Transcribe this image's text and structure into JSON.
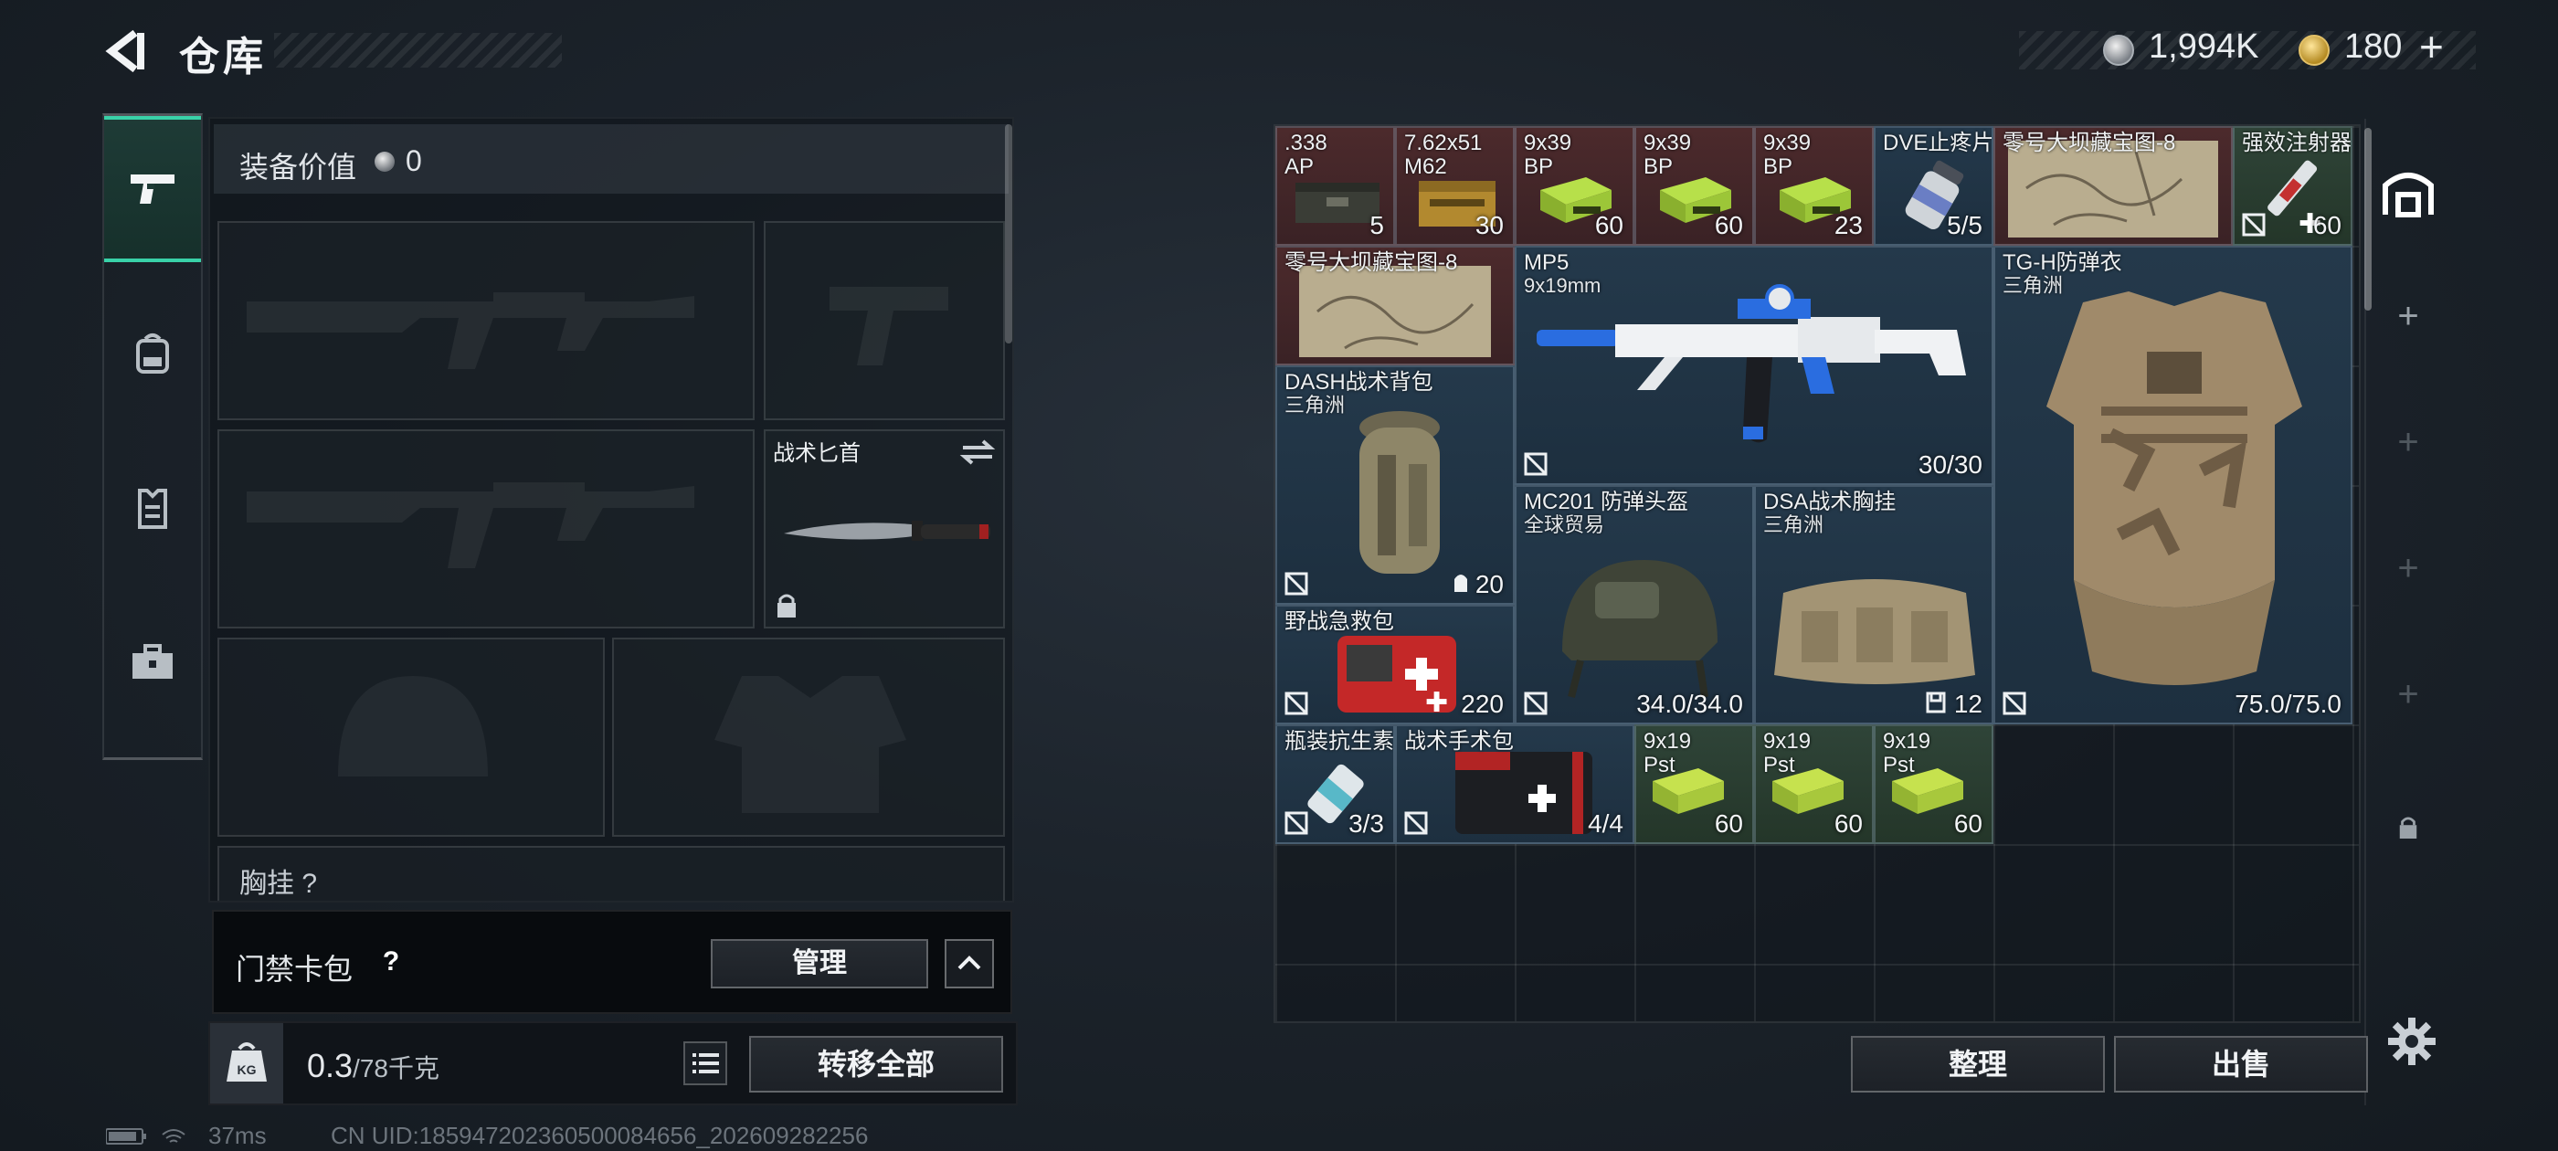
{
  "header": {
    "title": "仓库",
    "coins": "1,994K",
    "tickets": "180",
    "tickets_plus": "+"
  },
  "left_tabs": [
    {
      "icon": "pistol-icon",
      "active": true
    },
    {
      "icon": "backpack-icon",
      "active": false
    },
    {
      "icon": "vest-icon",
      "active": false
    },
    {
      "icon": "toolbox-icon",
      "active": false
    }
  ],
  "loadout": {
    "equip_value_label": "装备价值",
    "equip_value": "0",
    "knife_label": "战术匕首",
    "chest_rig_label": "胸挂",
    "chest_rig_count": "?"
  },
  "keycard": {
    "label": "门禁卡包",
    "help": "?",
    "manage_label": "管理"
  },
  "weight": {
    "current": "0.3",
    "max": "/78千克",
    "transfer_label": "转移全部"
  },
  "status": {
    "ping": "37ms",
    "uid": "CN UID:18594720236050008465‌6_202609282256"
  },
  "stash": {
    "items": [
      {
        "name": ".338\nAP",
        "count": "5",
        "color": "red",
        "icon": "ammo-box-icon"
      },
      {
        "name": "7.62x51\nM62",
        "count": "30",
        "color": "red",
        "icon": "ammo-box-icon"
      },
      {
        "name": "9x39\nBP",
        "count": "60",
        "color": "red",
        "icon": "ammo-box-icon"
      },
      {
        "name": "9x39\nBP",
        "count": "60",
        "color": "red",
        "icon": "ammo-box-icon"
      },
      {
        "name": "9x39\nBP",
        "count": "23",
        "color": "red",
        "icon": "ammo-box-icon"
      },
      {
        "name": "DVE止疼片",
        "count": "5/5",
        "color": "blue",
        "icon": "pill-bottle-icon"
      },
      {
        "name": "零号大坝藏宝图-8",
        "count": "",
        "color": "red",
        "icon": "map-icon"
      },
      {
        "name": "强效注射器",
        "count": "60",
        "color": "green",
        "icon": "syringe-icon"
      },
      {
        "name": "零号大坝藏宝图-8",
        "count": "",
        "color": "red",
        "icon": "map-icon"
      },
      {
        "name": "MP5",
        "sub": "9x19mm",
        "count": "30/30",
        "color": "blue",
        "icon": "smg-icon"
      },
      {
        "name": "TG-H防弹衣",
        "sub": "三角洲",
        "count": "75.0/75.0",
        "color": "blue",
        "icon": "armor-vest-icon"
      },
      {
        "name": "DASH战术背包",
        "sub": "三角洲",
        "count": "20",
        "color": "blue",
        "icon": "backpack-icon"
      },
      {
        "name": "MC201 防弹头盔",
        "sub": "全球贸易",
        "count": "34.0/34.0",
        "color": "blue",
        "icon": "helmet-icon"
      },
      {
        "name": "DSA战术胸挂",
        "sub": "三角洲",
        "count": "12",
        "color": "blue",
        "icon": "chest-rig-icon"
      },
      {
        "name": "野战急救包",
        "count": "220",
        "color": "blue",
        "icon": "first-aid-icon"
      },
      {
        "name": "瓶装抗生素",
        "count": "3/3",
        "color": "blue",
        "icon": "pill-bottle-icon"
      },
      {
        "name": "战术手术包",
        "count": "4/4",
        "color": "blue",
        "icon": "surgery-kit-icon"
      },
      {
        "name": "9x19\nPst",
        "count": "60",
        "color": "green",
        "icon": "ammo-box-icon"
      },
      {
        "name": "9x19\nPst",
        "count": "60",
        "color": "green",
        "icon": "ammo-box-icon"
      },
      {
        "name": "9x19\nPst",
        "count": "60",
        "color": "green",
        "icon": "ammo-box-icon"
      }
    ],
    "sort_label": "整理",
    "sell_label": "出售"
  },
  "right_tabs": [
    "stash-icon",
    "add-icon",
    "add-icon",
    "add-icon",
    "add-icon",
    "lock-icon"
  ],
  "colors": {
    "accent": "#39d1a8",
    "red_tier": "#4c2a2c",
    "blue_tier": "#24394b",
    "green_tier": "#2f4438"
  }
}
